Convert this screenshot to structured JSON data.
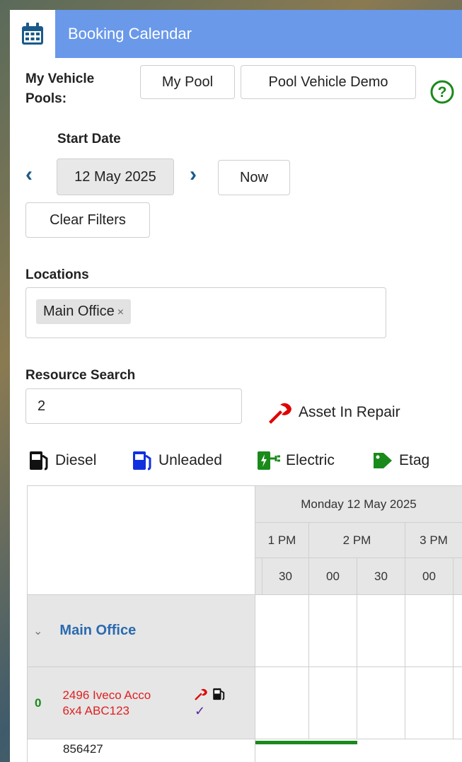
{
  "app": {
    "title": "Booking Calendar",
    "icon": "calendar-icon",
    "accent": "#6a99ea"
  },
  "pools": {
    "label": "My Vehicle Pools:",
    "buttons": [
      "My Pool",
      "Pool Vehicle Demo"
    ],
    "help_icon": "help-circle-icon"
  },
  "start_date": {
    "label": "Start Date",
    "value": "12 May 2025",
    "now_label": "Now",
    "clear_label": "Clear Filters"
  },
  "locations": {
    "label": "Locations",
    "selected": "Main Office",
    "remove": "×"
  },
  "resource_search": {
    "label": "Resource Search",
    "value": "2"
  },
  "legend": {
    "repair": "Asset In Repair",
    "diesel": "Diesel",
    "unleaded": "Unleaded",
    "electric": "Electric",
    "etag": "Etag",
    "colors": {
      "repair": "#e00000",
      "diesel": "#111111",
      "unleaded": "#1030e0",
      "electric": "#1a8a1a",
      "etag": "#1a8a1a"
    }
  },
  "calendar": {
    "day": "Monday 12 May 2025",
    "hours": [
      "1 PM",
      "2 PM",
      "3 PM"
    ],
    "minutes": [
      "30",
      "00",
      "30",
      "00"
    ],
    "group": "Main Office",
    "rows": [
      {
        "count": "0",
        "name_line1": "2496 Iveco Acco",
        "name_line2": "6x4 ABC123"
      },
      {
        "name_line1": "856427"
      }
    ]
  }
}
